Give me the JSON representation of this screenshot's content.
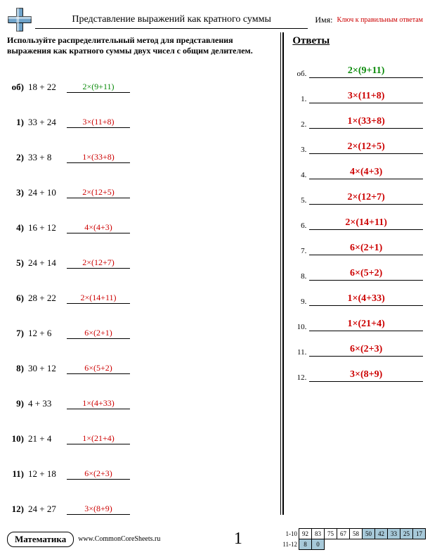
{
  "header": {
    "title": "Представление выражений как кратного суммы",
    "name_label": "Имя:",
    "key_label": "Ключ к правильным ответам"
  },
  "instructions": "Используйте распределительный метод для представления выражения как кратного суммы двух чисел с общим делителем.",
  "answers_header": "Ответы",
  "problems": [
    {
      "num": "об)",
      "expr": "18 + 22",
      "ans": "2×(9+11)",
      "example": true
    },
    {
      "num": "1)",
      "expr": "33 + 24",
      "ans": "3×(11+8)"
    },
    {
      "num": "2)",
      "expr": "33 + 8",
      "ans": "1×(33+8)"
    },
    {
      "num": "3)",
      "expr": "24 + 10",
      "ans": "2×(12+5)"
    },
    {
      "num": "4)",
      "expr": "16 + 12",
      "ans": "4×(4+3)"
    },
    {
      "num": "5)",
      "expr": "24 + 14",
      "ans": "2×(12+7)"
    },
    {
      "num": "6)",
      "expr": "28 + 22",
      "ans": "2×(14+11)"
    },
    {
      "num": "7)",
      "expr": "12 + 6",
      "ans": "6×(2+1)"
    },
    {
      "num": "8)",
      "expr": "30 + 12",
      "ans": "6×(5+2)"
    },
    {
      "num": "9)",
      "expr": "4 + 33",
      "ans": "1×(4+33)"
    },
    {
      "num": "10)",
      "expr": "21 + 4",
      "ans": "1×(21+4)"
    },
    {
      "num": "11)",
      "expr": "12 + 18",
      "ans": "6×(2+3)"
    },
    {
      "num": "12)",
      "expr": "24 + 27",
      "ans": "3×(8+9)"
    }
  ],
  "answers": [
    {
      "num": "об.",
      "val": "2×(9+11)",
      "example": true
    },
    {
      "num": "1.",
      "val": "3×(11+8)"
    },
    {
      "num": "2.",
      "val": "1×(33+8)"
    },
    {
      "num": "3.",
      "val": "2×(12+5)"
    },
    {
      "num": "4.",
      "val": "4×(4+3)"
    },
    {
      "num": "5.",
      "val": "2×(12+7)"
    },
    {
      "num": "6.",
      "val": "2×(14+11)"
    },
    {
      "num": "7.",
      "val": "6×(2+1)"
    },
    {
      "num": "8.",
      "val": "6×(5+2)"
    },
    {
      "num": "9.",
      "val": "1×(4+33)"
    },
    {
      "num": "10.",
      "val": "1×(21+4)"
    },
    {
      "num": "11.",
      "val": "6×(2+3)"
    },
    {
      "num": "12.",
      "val": "3×(8+9)"
    }
  ],
  "footer": {
    "subject": "Математика",
    "site": "www.CommonCoreSheets.ru",
    "page_number": "1",
    "score_rows": [
      {
        "label": "1-10",
        "cells": [
          "92",
          "83",
          "75",
          "67",
          "58",
          "50",
          "42",
          "33",
          "25",
          "17"
        ],
        "shade_from": 5
      },
      {
        "label": "11-12",
        "cells": [
          "8",
          "0"
        ],
        "shade_from": 0
      }
    ]
  }
}
